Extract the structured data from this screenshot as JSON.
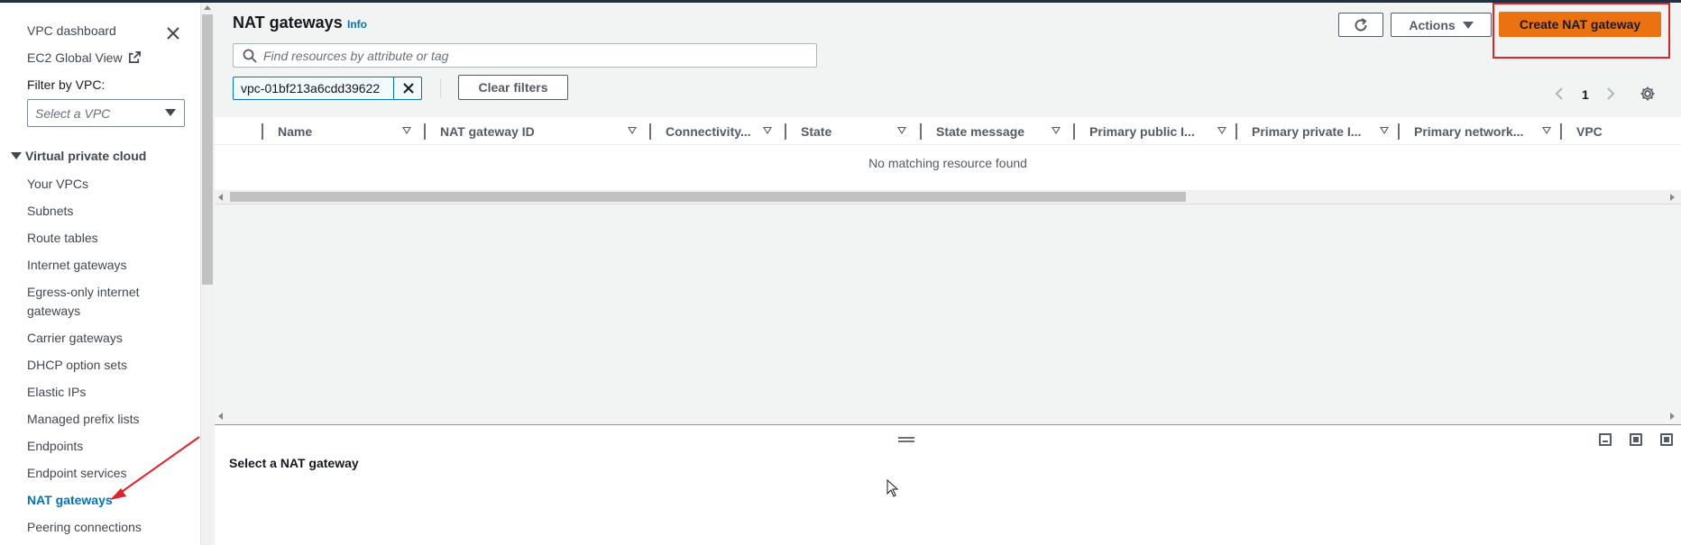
{
  "sidebar": {
    "close_label": "",
    "top_links": [
      {
        "label": "VPC dashboard"
      },
      {
        "label": "EC2 Global View"
      }
    ],
    "filter_label": "Filter by VPC:",
    "filter_placeholder": "Select a VPC",
    "section_title": "Virtual private cloud",
    "items": [
      {
        "label": "Your VPCs"
      },
      {
        "label": "Subnets"
      },
      {
        "label": "Route tables"
      },
      {
        "label": "Internet gateways"
      },
      {
        "label": "Egress-only internet"
      },
      {
        "label": "gateways"
      },
      {
        "label": "Carrier gateways"
      },
      {
        "label": "DHCP option sets"
      },
      {
        "label": "Elastic IPs"
      },
      {
        "label": "Managed prefix lists"
      },
      {
        "label": "Endpoints"
      },
      {
        "label": "Endpoint services"
      },
      {
        "label": "NAT gateways"
      },
      {
        "label": "Peering connections"
      }
    ]
  },
  "header": {
    "title": "NAT gateways",
    "info": "Info",
    "actions_label": "Actions",
    "create_label": "Create NAT gateway"
  },
  "filter": {
    "search_placeholder": "Find resources by attribute or tag",
    "token": "vpc-01bf213a6cdd39622",
    "clear_label": "Clear filters"
  },
  "pagination": {
    "current_page": "1"
  },
  "table": {
    "columns": [
      {
        "label": "Name"
      },
      {
        "label": "NAT gateway ID"
      },
      {
        "label": "Connectivity..."
      },
      {
        "label": "State"
      },
      {
        "label": "State message"
      },
      {
        "label": "Primary public I..."
      },
      {
        "label": "Primary private I..."
      },
      {
        "label": "Primary network..."
      },
      {
        "label": "VPC"
      }
    ],
    "empty_message": "No matching resource found"
  },
  "split_panel": {
    "title": "Select a NAT gateway"
  },
  "colors": {
    "primary": "#ec7211",
    "link": "#0073bb",
    "annotation": "#e0232b"
  }
}
